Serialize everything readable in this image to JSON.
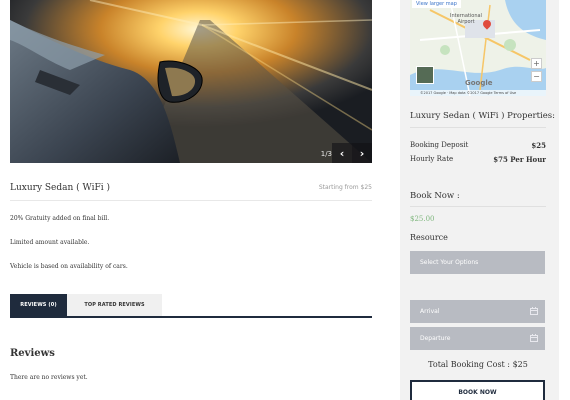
{
  "gallery": {
    "counter": "1/3",
    "prev_icon": "chevron-left-icon",
    "next_icon": "chevron-right-icon",
    "prev_glyph": "‹",
    "next_glyph": "›"
  },
  "listing": {
    "title": "Luxury Sedan ( WiFi )",
    "starting_from": "Starting from $25",
    "notes": [
      "20% Gratuity added on final bill.",
      "Limited amount available.",
      "Vehicle is based on availability of cars."
    ]
  },
  "tabs": [
    {
      "label": "REVIEWS (0)",
      "active": true
    },
    {
      "label": "TOP RATED REVIEWS",
      "active": false
    }
  ],
  "reviews": {
    "heading": "Reviews",
    "empty_text": "There are no reviews yet."
  },
  "map": {
    "larger_map_link": "View larger map",
    "place_label": "International Airport",
    "logo": "Google",
    "footer": "©2017 Google · Map data ©2017 Google   Terms of Use",
    "zoom_in": "+",
    "zoom_out": "−"
  },
  "properties": {
    "title": "Luxury Sedan ( WiFi ) Properties:",
    "rows": [
      {
        "label": "Booking Deposit",
        "value": "$25"
      },
      {
        "label": "Hourly Rate",
        "value": "$75 Per Hour"
      }
    ]
  },
  "booking": {
    "title": "Book Now :",
    "price": "$25.00",
    "resource_label": "Resource",
    "resource_placeholder": "Select Your Options",
    "arrival_placeholder": "Arrival",
    "departure_placeholder": "Departure",
    "total_label": "Total Booking Cost :",
    "total_value": "$25",
    "button_label": "BOOK NOW"
  },
  "colors": {
    "navy": "#1f2b3d",
    "price_green": "#7fb77e",
    "field_gray": "#b8bbc2",
    "sidebar_bg": "#f2f2f2"
  }
}
